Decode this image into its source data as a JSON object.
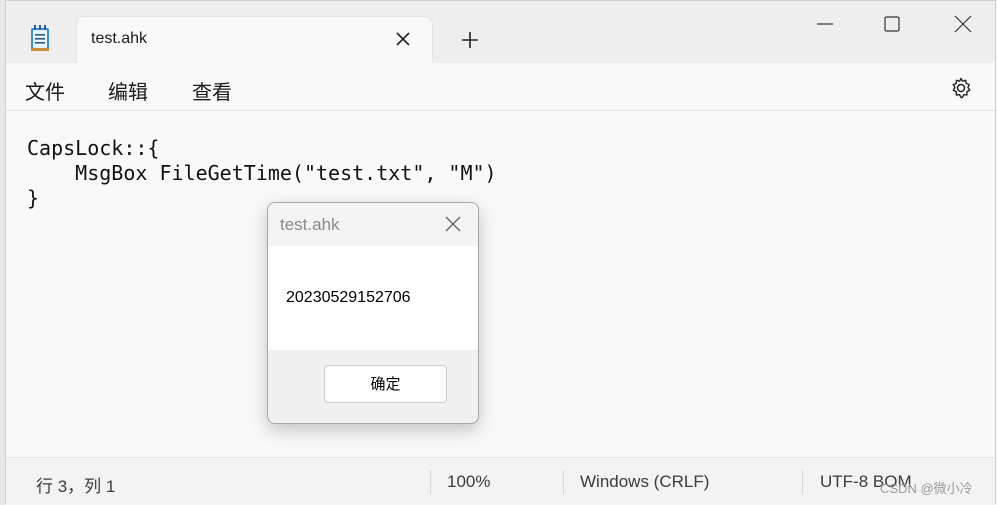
{
  "tab": {
    "title": "test.ahk"
  },
  "menu": {
    "file": "文件",
    "edit": "编辑",
    "view": "查看"
  },
  "editor": {
    "lines": [
      "CapsLock::{",
      "    MsgBox FileGetTime(\"test.txt\", \"M\")",
      "}"
    ]
  },
  "status": {
    "position": "行 3，列 1",
    "zoom": "100%",
    "line_ending": "Windows (CRLF)",
    "encoding": "UTF-8 BOM"
  },
  "watermark": "CSDN @微小冷",
  "msgbox": {
    "title": "test.ahk",
    "message": "20230529152706",
    "ok_label": "确定"
  },
  "icons": {
    "app": "notepad-icon",
    "tab_close": "close-icon",
    "new_tab": "plus-icon",
    "minimize": "minimize-icon",
    "maximize": "maximize-icon",
    "close": "close-icon",
    "settings": "gear-icon"
  },
  "colors": {
    "background": "#f3f3f3",
    "editor": "#f9f9f9",
    "accent": "#2b6cb0"
  }
}
